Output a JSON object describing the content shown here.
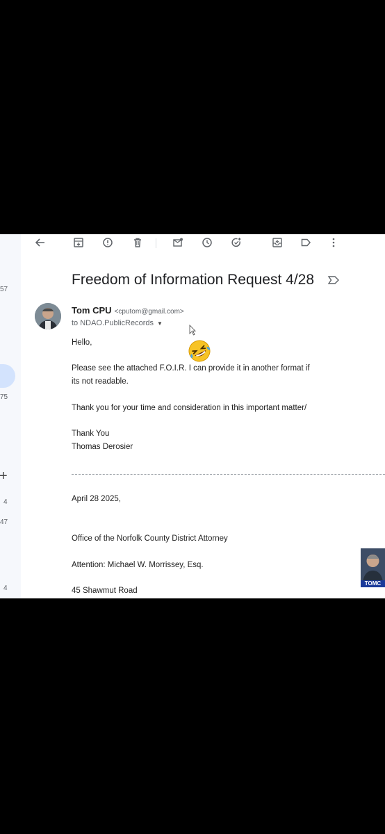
{
  "left_rail": {
    "counts": [
      "57",
      "75",
      "4",
      "47",
      "4"
    ],
    "plus": "+"
  },
  "toolbar": {
    "icons": [
      "back-arrow-icon",
      "archive-icon",
      "report-spam-icon",
      "delete-icon",
      "mark-unread-icon",
      "snooze-icon",
      "add-task-icon",
      "move-to-icon",
      "label-icon",
      "more-vert-icon"
    ]
  },
  "email": {
    "subject": "Freedom of Information Request 4/28",
    "sender_name": "Tom CPU",
    "sender_email": "<cputom@gmail.com>",
    "to_line": "to NDAO.PublicRecords",
    "greeting": "Hello,",
    "body_line1": "Please see the attached F.O.I.R. I can provide it in another format if",
    "body_line2": "its not readable.",
    "body_line3": "Thank you for your time and consideration in this important matter/",
    "signoff1": "Thank You",
    "signoff2": "Thomas Derosier",
    "letter_date": "April 28 2025,",
    "letter_office": "Office of the Norfolk County District Attorney",
    "letter_attention": "Attention: Michael W. Morrissey, Esq.",
    "letter_address": "45 Shawmut Road"
  },
  "overlay": {
    "emoji": "rolling-on-floor-laughing",
    "cam_label": "TOMC"
  },
  "colors": {
    "background": "#000000",
    "page": "#ffffff",
    "rail": "#f6f8fc",
    "rail_pill": "#d3e3fd"
  }
}
